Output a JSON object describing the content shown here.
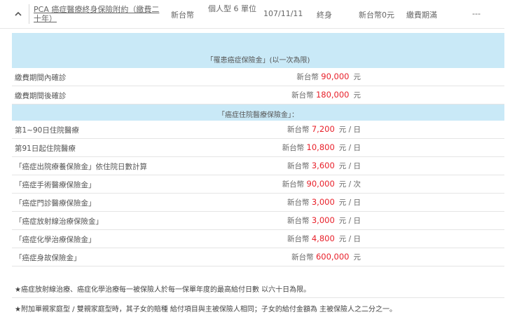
{
  "summary": {
    "plan_name": "PCA 癌症醫療終身保險附約（繳費二十年）",
    "currency": "新台幣",
    "unit_type": "個人型 6 單位",
    "date": "107/11/11",
    "term": "終身",
    "amount": "新台幣0元",
    "status": "繳費期滿",
    "extra": "---"
  },
  "benefits": {
    "main_header": "「罹患癌症保險金」(以一次為限)",
    "diagnosis_rows": [
      {
        "label": "繳費期間內確診",
        "prefix": "新台幣",
        "value": "90,000",
        "unit": "元"
      },
      {
        "label": "繳費期間後確診",
        "prefix": "新台幣",
        "value": "180,000",
        "unit": "元"
      }
    ],
    "hosp_header": "「癌症住院醫療保險金」：",
    "hosp_rows": [
      {
        "label": "第1~90日住院醫療",
        "prefix": "新台幣",
        "value": "7,200",
        "unit": "元 / 日"
      },
      {
        "label": "第91日起住院醫療",
        "prefix": "新台幣",
        "value": "10,800",
        "unit": "元 / 日"
      },
      {
        "label": "「癌症出院療養保險金」依住院日數計算",
        "prefix": "新台幣",
        "value": "3,600",
        "unit": "元 / 日"
      },
      {
        "label": "「癌症手術醫療保險金」",
        "prefix": "新台幣",
        "value": "90,000",
        "unit": "元 / 次"
      },
      {
        "label": "「癌症門診醫療保險金」",
        "prefix": "新台幣",
        "value": "3,000",
        "unit": "元 / 日"
      },
      {
        "label": "「癌症放射線治療保險金」",
        "prefix": "新台幣",
        "value": "3,000",
        "unit": "元 / 日"
      },
      {
        "label": "「癌症化學治療保險金」",
        "prefix": "新台幣",
        "value": "4,800",
        "unit": "元 / 日"
      },
      {
        "label": "「癌症身故保險金」",
        "prefix": "新台幣",
        "value": "600,000",
        "unit": "元"
      }
    ]
  },
  "notes": [
    "★癌症放射線治療、癌症化學治療每一被保險人於每一保單年度的最高給付日數 以六十日為限。",
    "★附加單親家庭型 / 雙親家庭型時，其子女的賠種 給付項目與主被保險人相同；子女的給付金額為 主被保險人之二分之一。"
  ],
  "colors": {
    "accent": "#1e8cc8",
    "highlight": "#e8202a",
    "band": "#c9e9f7"
  },
  "icons": {
    "collapse": "chevron-up-icon"
  }
}
